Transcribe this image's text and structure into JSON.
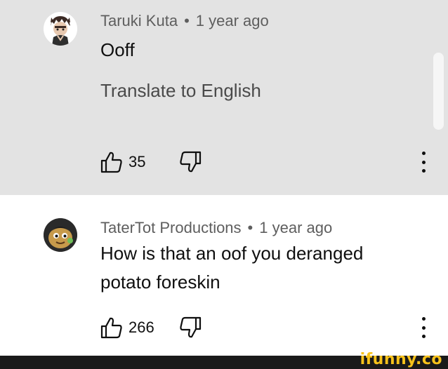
{
  "comments": [
    {
      "author": "Taruki Kuta",
      "separator": "•",
      "time": "1 year ago",
      "text": "Ooff",
      "translate": "Translate to English",
      "likes": "35"
    },
    {
      "author": "TaterTot Productions",
      "separator": "•",
      "time": "1 year ago",
      "text": "How is that an oof you deranged potato foreskin",
      "likes": "266"
    }
  ],
  "watermark": "ifunny.co",
  "colors": {
    "highlight_bg": "#e3e3e3",
    "meta_text": "#5e5e5e",
    "watermark": "#f7c21a"
  },
  "icons": [
    "thumb-up-icon",
    "thumb-down-icon",
    "more-vert-icon"
  ]
}
